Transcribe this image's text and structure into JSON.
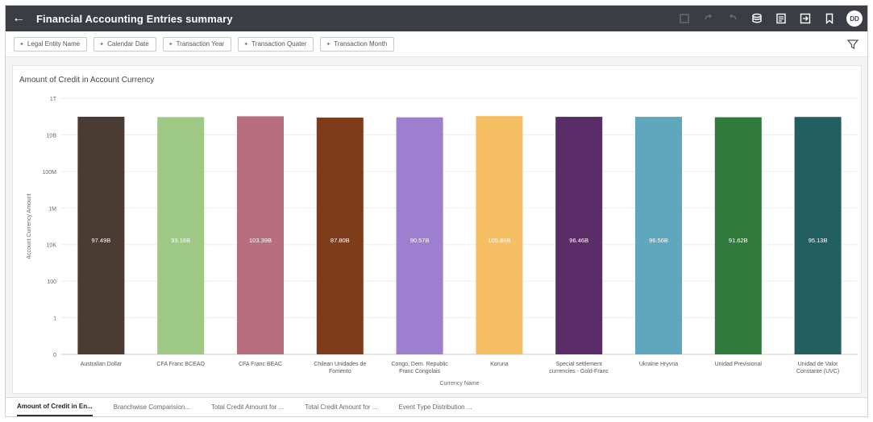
{
  "window": {
    "title": "Financial Accounting Entries summary",
    "avatar_initials": "DD",
    "toolbar_icons": [
      "undo-icon",
      "redo-icon",
      "refresh-icon",
      "data-icon",
      "present-icon",
      "export-icon",
      "bookmark-icon"
    ]
  },
  "filters": [
    {
      "label": "Legal Entity Name"
    },
    {
      "label": "Calendar Date"
    },
    {
      "label": "Transaction Year"
    },
    {
      "label": "Transaction Quater"
    },
    {
      "label": "Transaction Month"
    }
  ],
  "tabs": [
    {
      "label": "Amount of Credit in En...",
      "active": true
    },
    {
      "label": "Branchwise Comparision...",
      "active": false
    },
    {
      "label": "Total Credit Amount for ...",
      "active": false
    },
    {
      "label": "Total Credit Amount for ...",
      "active": false
    },
    {
      "label": "Event Type Distribution ...",
      "active": false
    }
  ],
  "chart_data": {
    "type": "bar",
    "title": "Amount of Credit in Account Currency",
    "xlabel": "Currency Name",
    "ylabel": "Account Currency Amount",
    "y_scale": "log",
    "y_ticks": [
      "1T",
      "10B",
      "100M",
      "1M",
      "10K",
      "100",
      "1",
      "0"
    ],
    "categories": [
      [
        "Australian Dollar"
      ],
      [
        "CFA Franc BCEAO"
      ],
      [
        "CFA Franc BEAC"
      ],
      [
        "Chilean Unidades de",
        "Fomento"
      ],
      [
        "Congo, Dem. Republic",
        "Franc Congolais"
      ],
      [
        "Koruna"
      ],
      [
        "Special settlement",
        "currencies - Gold-Franc"
      ],
      [
        "Ukraine Hryvna"
      ],
      [
        "Unidad Previsional"
      ],
      [
        "Unidad de Valor",
        "Constante (UVC)"
      ]
    ],
    "values": [
      97490000000,
      93160000000,
      103390000000,
      87800000000,
      90570000000,
      105880000000,
      96460000000,
      96560000000,
      91620000000,
      95130000000
    ],
    "data_labels": [
      "97.49B",
      "93.16B",
      "103.39B",
      "87.80B",
      "90.57B",
      "105.88B",
      "96.46B",
      "96.56B",
      "91.62B",
      "95.13B"
    ],
    "colors": [
      "#4a3b33",
      "#9ec984",
      "#b76f7f",
      "#7f3c1b",
      "#9e7fcf",
      "#f7bf63",
      "#5b2d68",
      "#5fa7bd",
      "#307a3c",
      "#235f61"
    ],
    "label_colors": [
      "#ffffff",
      "#ffffff",
      "#ffffff",
      "#ffffff",
      "#ffffff",
      "#ffffff",
      "#ffffff",
      "#ffffff",
      "#ffffff",
      "#ffffff"
    ],
    "grid": true,
    "legend": "none"
  }
}
